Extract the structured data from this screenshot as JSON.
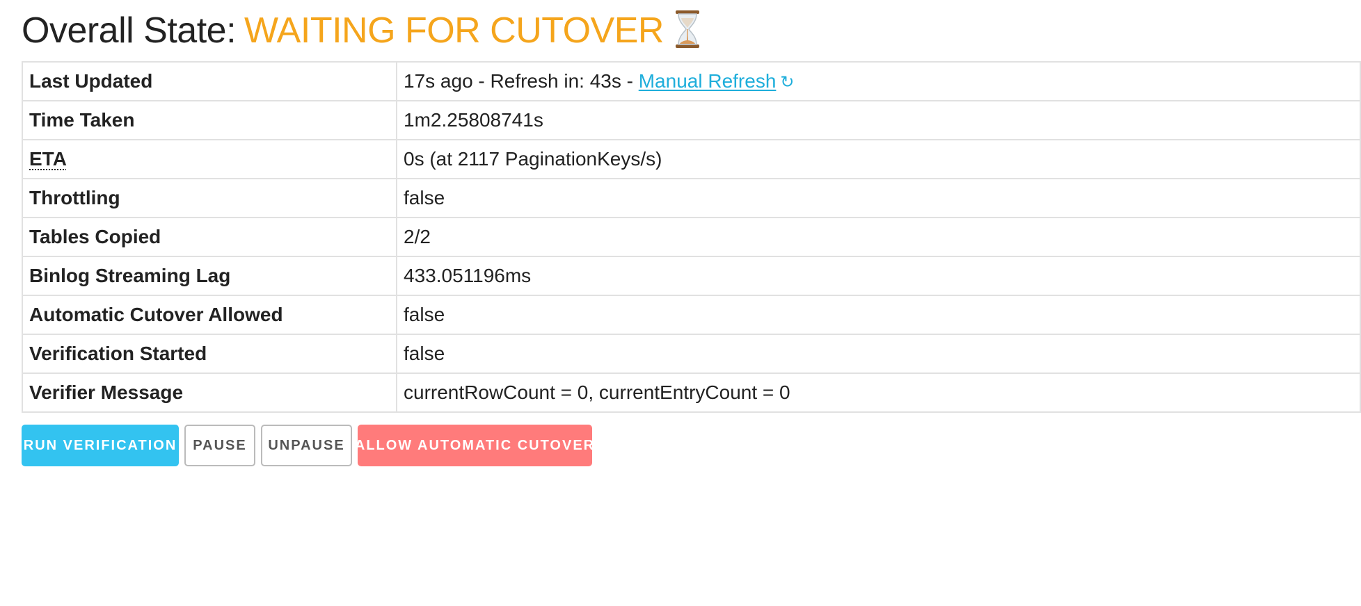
{
  "header": {
    "label": "Overall State:",
    "state": "WAITING FOR CUTOVER",
    "state_color": "#f5a51c",
    "icon": "hourglass-icon"
  },
  "status_table": {
    "rows": [
      {
        "key": "Last Updated",
        "value": "17s ago - Refresh in: 43s - ",
        "link": "Manual Refresh",
        "link_icon": "↻"
      },
      {
        "key": "Time Taken",
        "value": "1m2.25808741s"
      },
      {
        "key": "ETA",
        "value": "0s (at 2117 PaginationKeys/s)"
      },
      {
        "key": "Throttling",
        "value": "false"
      },
      {
        "key": "Tables Copied",
        "value": "2/2"
      },
      {
        "key": "Binlog Streaming Lag",
        "value": "433.051196ms"
      },
      {
        "key": "Automatic Cutover Allowed",
        "value": "false"
      },
      {
        "key": "Verification Started",
        "value": "false"
      },
      {
        "key": "Verifier Message",
        "value": "currentRowCount = 0, currentEntryCount = 0"
      }
    ]
  },
  "actions": {
    "run_verification": "Run Verification",
    "pause": "Pause",
    "unpause": "Unpause",
    "allow_automatic_cutover": "Allow Automatic Cutover"
  },
  "colors": {
    "primary": "#33c3f0",
    "danger": "#ff7b7b",
    "link": "#1eaedb",
    "border": "#e1e1e1"
  }
}
